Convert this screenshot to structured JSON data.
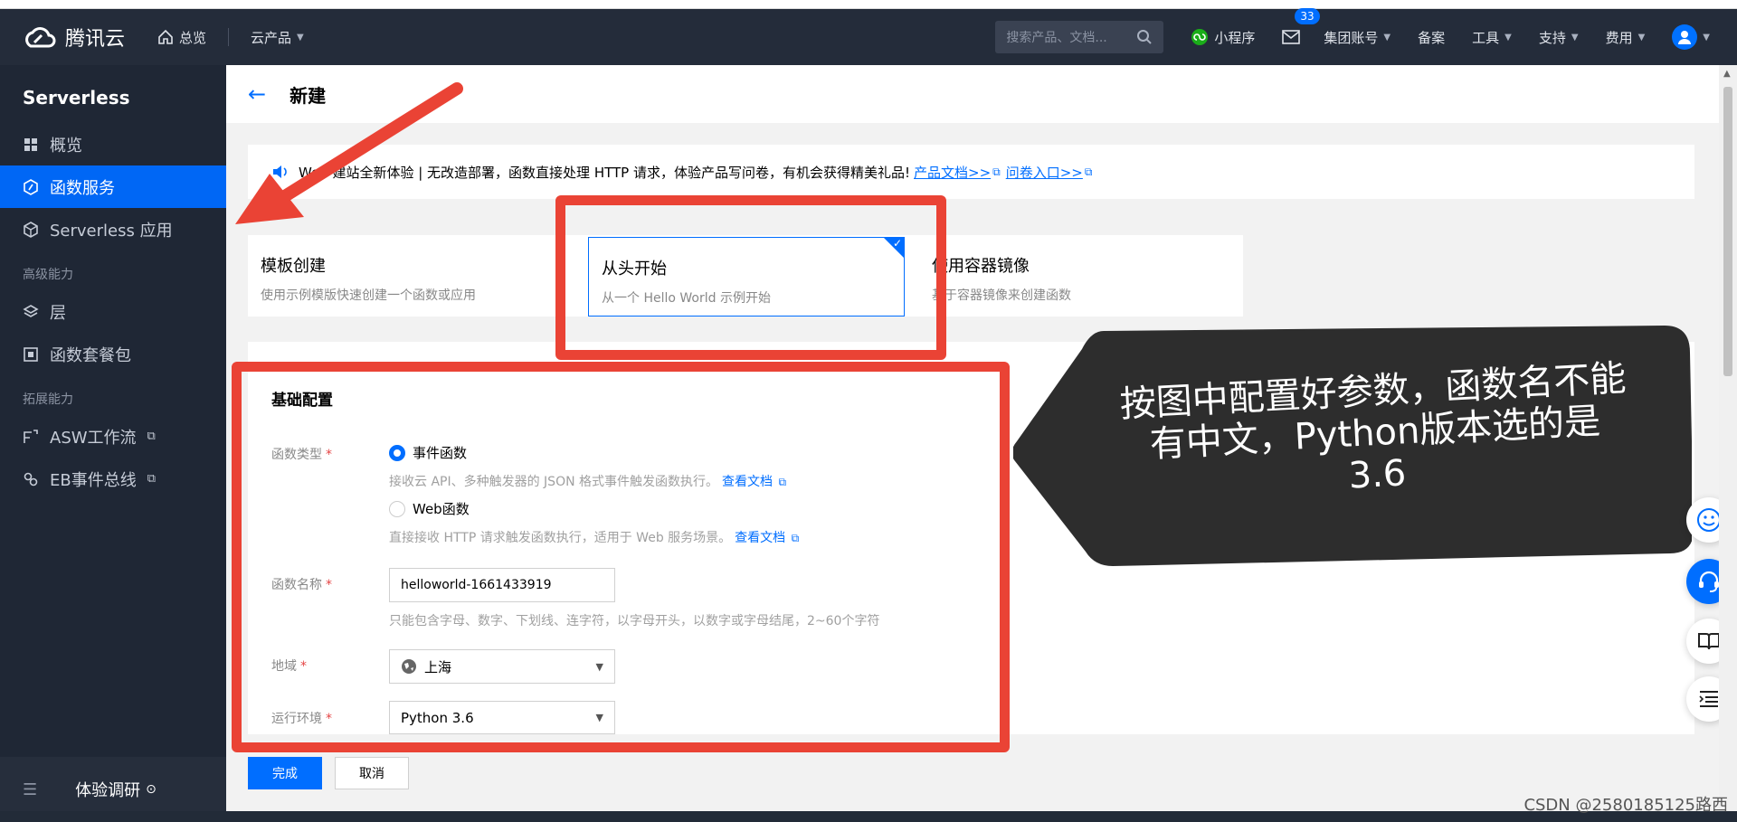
{
  "topbar": {
    "logo_text": "腾讯云",
    "nav_overview": "总览",
    "nav_products": "云产品",
    "search_placeholder": "搜索产品、文档...",
    "mini_program": "小程序",
    "mail_badge": "33",
    "group_account": "集团账号",
    "record": "备案",
    "tools": "工具",
    "support": "支持",
    "billing": "费用"
  },
  "sidebar": {
    "title": "Serverless",
    "items": [
      {
        "label": "概览",
        "icon": "grid-icon"
      },
      {
        "label": "函数服务",
        "icon": "function-icon"
      },
      {
        "label": "Serverless 应用",
        "icon": "cube-icon"
      }
    ],
    "group_advanced": "高级能力",
    "advanced_items": [
      {
        "label": "层",
        "icon": "layers-icon"
      },
      {
        "label": "函数套餐包",
        "icon": "package-icon"
      }
    ],
    "group_extension": "拓展能力",
    "extension_items": [
      {
        "label": "ASW工作流",
        "icon": "workflow-icon"
      },
      {
        "label": "EB事件总线",
        "icon": "eventbus-icon"
      }
    ],
    "survey": "体验调研"
  },
  "page": {
    "title": "新建",
    "notice_text": "Web 建站全新体验 | 无改造部署，函数直接处理 HTTP 请求，体验产品写问卷，有机会获得精美礼品!",
    "notice_link_doc": "产品文档>>",
    "notice_link_survey": "问卷入口>>"
  },
  "create_options": [
    {
      "title": "模板创建",
      "desc": "使用示例模版快速创建一个函数或应用"
    },
    {
      "title": "从头开始",
      "desc": "从一个 Hello World 示例开始"
    },
    {
      "title": "使用容器镜像",
      "desc": "基于容器镜像来创建函数"
    }
  ],
  "form": {
    "section_title": "基础配置",
    "type_label": "函数类型",
    "type_event": "事件函数",
    "type_event_hint": "接收云 API、多种触发器的 JSON 格式事件触发函数执行。",
    "type_event_doc": "查看文档",
    "type_web": "Web函数",
    "type_web_hint": "直接接收 HTTP 请求触发函数执行，适用于 Web 服务场景。",
    "type_web_doc": "查看文档",
    "name_label": "函数名称",
    "name_value": "helloworld-1661433919",
    "name_hint": "只能包含字母、数字、下划线、连字符，以字母开头，以数字或字母结尾，2~60个字符",
    "region_label": "地域",
    "region_value": "上海",
    "runtime_label": "运行环境",
    "runtime_value": "Python 3.6",
    "required_mark": "*"
  },
  "buttons": {
    "confirm": "完成",
    "cancel": "取消"
  },
  "annotation": {
    "callout_text": "按图中配置好参数，函数名不能有中文，Python版本选的是3.6"
  },
  "watermark": "CSDN @2580185125路西"
}
